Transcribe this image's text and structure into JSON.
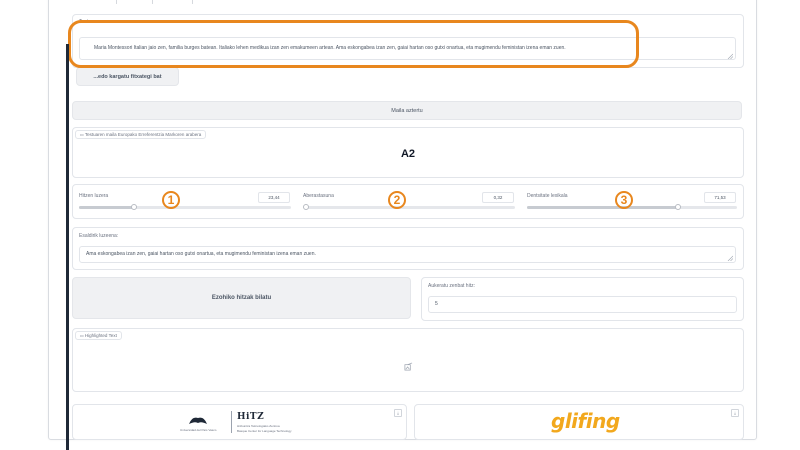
{
  "tabs": [
    "",
    "",
    ""
  ],
  "text_input": {
    "label": "Testua",
    "value": "Maria Montessori Italian jaio zen, familia burges batean. Italiako lehen medikua izan zen emakumeen artean. Ama eskongabea izan zen, gaiai hartan oso gutxi onartua, eta mugimendu feministan izena eman zuen."
  },
  "upload_button": {
    "label": "...edo kargatu fitxategi bat"
  },
  "analyze_button": {
    "label": "Maila aztertu"
  },
  "level_output": {
    "label": "Testuaren maila Europako Erreferentzia Markoren arabera",
    "value": "A2"
  },
  "sliders": [
    {
      "label": "Hitzen luzera",
      "value": "23,44",
      "fraction": 0.26,
      "badge": "1"
    },
    {
      "label": "Aberastasuna",
      "value": "0,32",
      "fraction": 0.0,
      "badge": "2"
    },
    {
      "label": "Dentsitate lexikala",
      "value": "71,53",
      "fraction": 0.72,
      "badge": "3"
    }
  ],
  "difficult_words": {
    "label": "Esaldirik luzeena:",
    "value": "Ama eskongabea izan zen, gaiai hartan oso gutxi onartua, eta mugimendu feministan izena eman zuen."
  },
  "find_words_button": {
    "label": "Ezohiko hitzak bilatu"
  },
  "word_count": {
    "label": "Aukeratu zenbat hitz:",
    "value": "5"
  },
  "highlighted": {
    "label": "Highlighted Text"
  },
  "footer": {
    "hitz_title": "HiTZ",
    "hitz_sub1": "Hizkuntza Teknologiako Zentroa",
    "hitz_sub2": "Basque Center for Language Technology",
    "ehu_small": "Universidad del País Vasco",
    "glifing": "glifing"
  },
  "colors": {
    "accent": "#e8871e",
    "button_bg": "#f0f1f3",
    "border": "#e2e5ea"
  }
}
